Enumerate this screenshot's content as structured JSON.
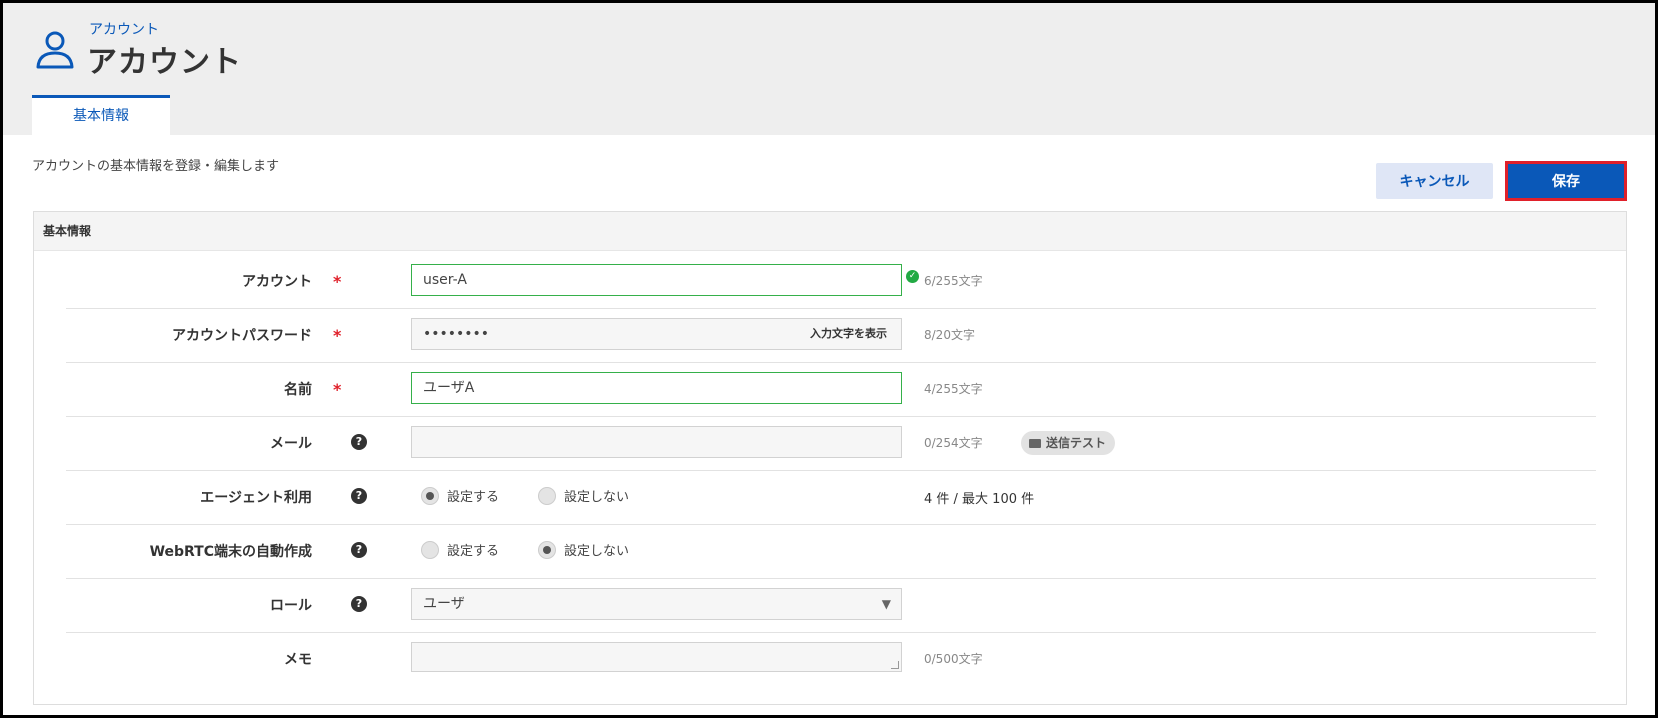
{
  "header": {
    "breadcrumb": "アカウント",
    "title": "アカウント",
    "tab_label": "基本情報"
  },
  "toolbar": {
    "description": "アカウントの基本情報を登録・編集します",
    "cancel_label": "キャンセル",
    "save_label": "保存"
  },
  "panel": {
    "heading": "基本情報"
  },
  "form": {
    "account": {
      "label": "アカウント",
      "required_mark": "*",
      "value": "user-A",
      "count": "6/255文字"
    },
    "password": {
      "label": "アカウントパスワード",
      "required_mark": "*",
      "value": "••••••••",
      "show_label": "入力文字を表示",
      "count": "8/20文字"
    },
    "name": {
      "label": "名前",
      "required_mark": "*",
      "value": "ユーザA",
      "count": "4/255文字"
    },
    "mail": {
      "label": "メール",
      "help": "?",
      "value": "",
      "count": "0/254文字",
      "send_test_label": "送信テスト"
    },
    "agent": {
      "label": "エージェント利用",
      "help": "?",
      "options": [
        "設定する",
        "設定しない"
      ],
      "selected": "設定する",
      "usage": "4 件 / 最大 100 件"
    },
    "webrtc": {
      "label": "WebRTC端末の自動作成",
      "help": "?",
      "options": [
        "設定する",
        "設定しない"
      ],
      "selected": "設定しない"
    },
    "role": {
      "label": "ロール",
      "help": "?",
      "value": "ユーザ",
      "caret": "▼"
    },
    "memo": {
      "label": "メモ",
      "value": "",
      "count": "0/500文字"
    }
  },
  "colors": {
    "accent": "#0a58b8",
    "required": "#e0202a",
    "valid_border": "#35b04a",
    "header_bg": "#eeeeee"
  },
  "icons": [
    "user-icon",
    "check-circle-icon",
    "help-circle-icon",
    "envelope-icon",
    "chevron-down-icon"
  ]
}
